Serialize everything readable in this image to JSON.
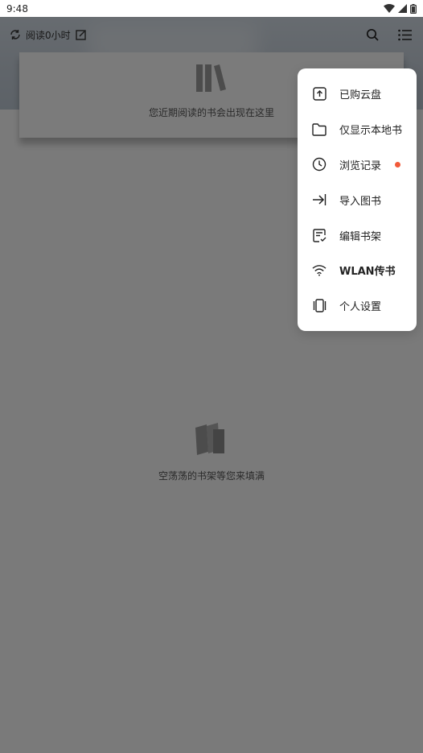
{
  "status_bar": {
    "time": "9:48"
  },
  "top_bar": {
    "reading_time": "阅读0小时"
  },
  "recent": {
    "hint": "您近期阅读的书会出现在这里"
  },
  "shelf": {
    "empty_text": "空荡荡的书架等您来填满"
  },
  "menu": {
    "items": [
      {
        "label": "已购云盘",
        "icon": "cloud-upload-icon"
      },
      {
        "label": "仅显示本地书",
        "icon": "folder-icon"
      },
      {
        "label": "浏览记录",
        "icon": "clock-icon",
        "badge": true
      },
      {
        "label": "导入图书",
        "icon": "import-arrow-icon"
      },
      {
        "label": "编辑书架",
        "icon": "edit-list-icon"
      },
      {
        "label": "WLAN传书",
        "icon": "wifi-icon"
      },
      {
        "label": "个人设置",
        "icon": "settings-device-icon"
      }
    ]
  },
  "colors": {
    "badge": "#f25a3a",
    "scrim": "rgba(0,0,0,0.5)"
  }
}
